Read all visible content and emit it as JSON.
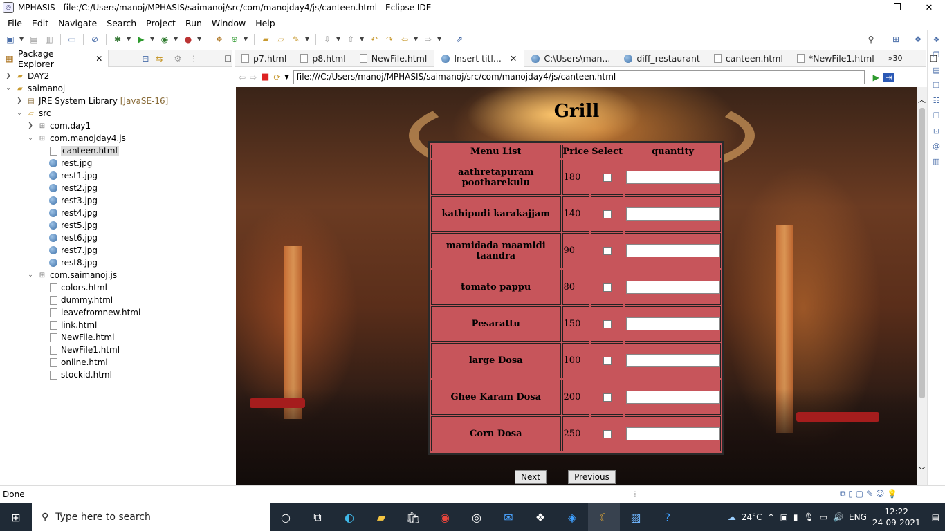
{
  "window": {
    "title": "MPHASIS - file:/C:/Users/manoj/MPHASIS/saimanoj/src/com/manojday4/js/canteen.html - Eclipse IDE",
    "minimize": "—",
    "maximize": "❐",
    "close": "✕"
  },
  "menubar": [
    "File",
    "Edit",
    "Navigate",
    "Search",
    "Project",
    "Run",
    "Window",
    "Help"
  ],
  "package_explorer": {
    "tab_label": "Package Explorer",
    "tree": [
      {
        "label": "DAY2"
      },
      {
        "label": "saimanoj"
      },
      {
        "label": "JRE System Library",
        "decoration": "[JavaSE-16]"
      },
      {
        "label": "src"
      },
      {
        "label": "com.day1"
      },
      {
        "label": "com.manojday4.js"
      },
      {
        "label": "canteen.html"
      },
      {
        "label": "rest.jpg"
      },
      {
        "label": "rest1.jpg"
      },
      {
        "label": "rest2.jpg"
      },
      {
        "label": "rest3.jpg"
      },
      {
        "label": "rest4.jpg"
      },
      {
        "label": "rest5.jpg"
      },
      {
        "label": "rest6.jpg"
      },
      {
        "label": "rest7.jpg"
      },
      {
        "label": "rest8.jpg"
      },
      {
        "label": "com.saimanoj.js"
      },
      {
        "label": "colors.html"
      },
      {
        "label": "dummy.html"
      },
      {
        "label": "leavefromnew.html"
      },
      {
        "label": "link.html"
      },
      {
        "label": "NewFile.html"
      },
      {
        "label": "NewFile1.html"
      },
      {
        "label": "online.html"
      },
      {
        "label": "stockid.html"
      }
    ]
  },
  "editor_tabs": [
    {
      "label": "p7.html"
    },
    {
      "label": "p8.html"
    },
    {
      "label": "NewFile.html"
    },
    {
      "label": "Insert titl..."
    },
    {
      "label": "C:\\Users\\man..."
    },
    {
      "label": "diff_restaurant"
    },
    {
      "label": "canteen.html"
    },
    {
      "label": "*NewFile1.html"
    }
  ],
  "editor_tabs_overflow": "»30",
  "browser": {
    "url": "file:///C:/Users/manoj/MPHASIS/saimanoj/src/com/manojday4/js/canteen.html",
    "page_title": "Grill",
    "table": {
      "headers": [
        "Menu List",
        "Price",
        "Select",
        "quantity"
      ],
      "rows": [
        {
          "name": "aathretapuram pootharekulu",
          "price": "180"
        },
        {
          "name": "kathipudi karakajjam",
          "price": "140"
        },
        {
          "name": "mamidada maamidi taandra",
          "price": "90"
        },
        {
          "name": "tomato pappu",
          "price": "80"
        },
        {
          "name": "Pesarattu",
          "price": "150"
        },
        {
          "name": "large Dosa",
          "price": "100"
        },
        {
          "name": "Ghee Karam Dosa",
          "price": "200"
        },
        {
          "name": "Corn Dosa",
          "price": "250"
        }
      ]
    },
    "next_label": "Next",
    "previous_label": "Previous"
  },
  "status": "Done",
  "taskbar": {
    "search_placeholder": "Type here to search",
    "weather": "24°C",
    "language": "ENG",
    "time": "12:22",
    "date": "24-09-2021"
  }
}
